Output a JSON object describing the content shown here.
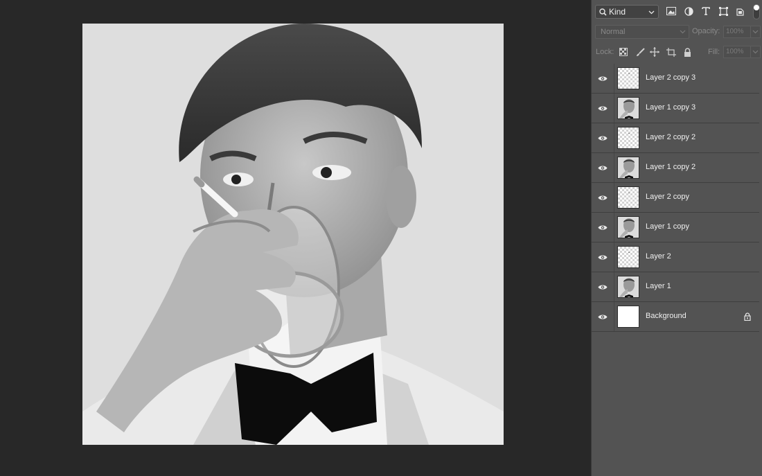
{
  "layers_panel": {
    "filter": {
      "kind_label": "Kind",
      "filter_icons": [
        "image-filter-icon",
        "adjustment-filter-icon",
        "type-filter-icon",
        "shape-filter-icon",
        "smart-object-filter-icon"
      ]
    },
    "blend_mode": "Normal",
    "opacity_label": "Opacity:",
    "opacity_value": "100%",
    "lock_label": "Lock:",
    "fill_label": "Fill:",
    "fill_value": "100%",
    "layers": [
      {
        "name": "Layer 2 copy 3",
        "thumb": "transparent",
        "visible": true,
        "locked": false
      },
      {
        "name": "Layer 1 copy 3",
        "thumb": "photo",
        "visible": true,
        "locked": false
      },
      {
        "name": "Layer 2 copy 2",
        "thumb": "transparent",
        "visible": true,
        "locked": false
      },
      {
        "name": "Layer 1 copy 2",
        "thumb": "photo",
        "visible": true,
        "locked": false
      },
      {
        "name": "Layer 2 copy",
        "thumb": "transparent",
        "visible": true,
        "locked": false
      },
      {
        "name": "Layer 1 copy",
        "thumb": "photo",
        "visible": true,
        "locked": false
      },
      {
        "name": "Layer 2",
        "thumb": "transparent",
        "visible": true,
        "locked": false
      },
      {
        "name": "Layer 1",
        "thumb": "photo",
        "visible": true,
        "locked": false
      },
      {
        "name": "Background",
        "thumb": "white",
        "visible": true,
        "locked": true
      }
    ]
  },
  "colors": {
    "workspace_bg": "#282828",
    "panel_bg": "#535353",
    "row_divider": "#3e3e3e"
  }
}
